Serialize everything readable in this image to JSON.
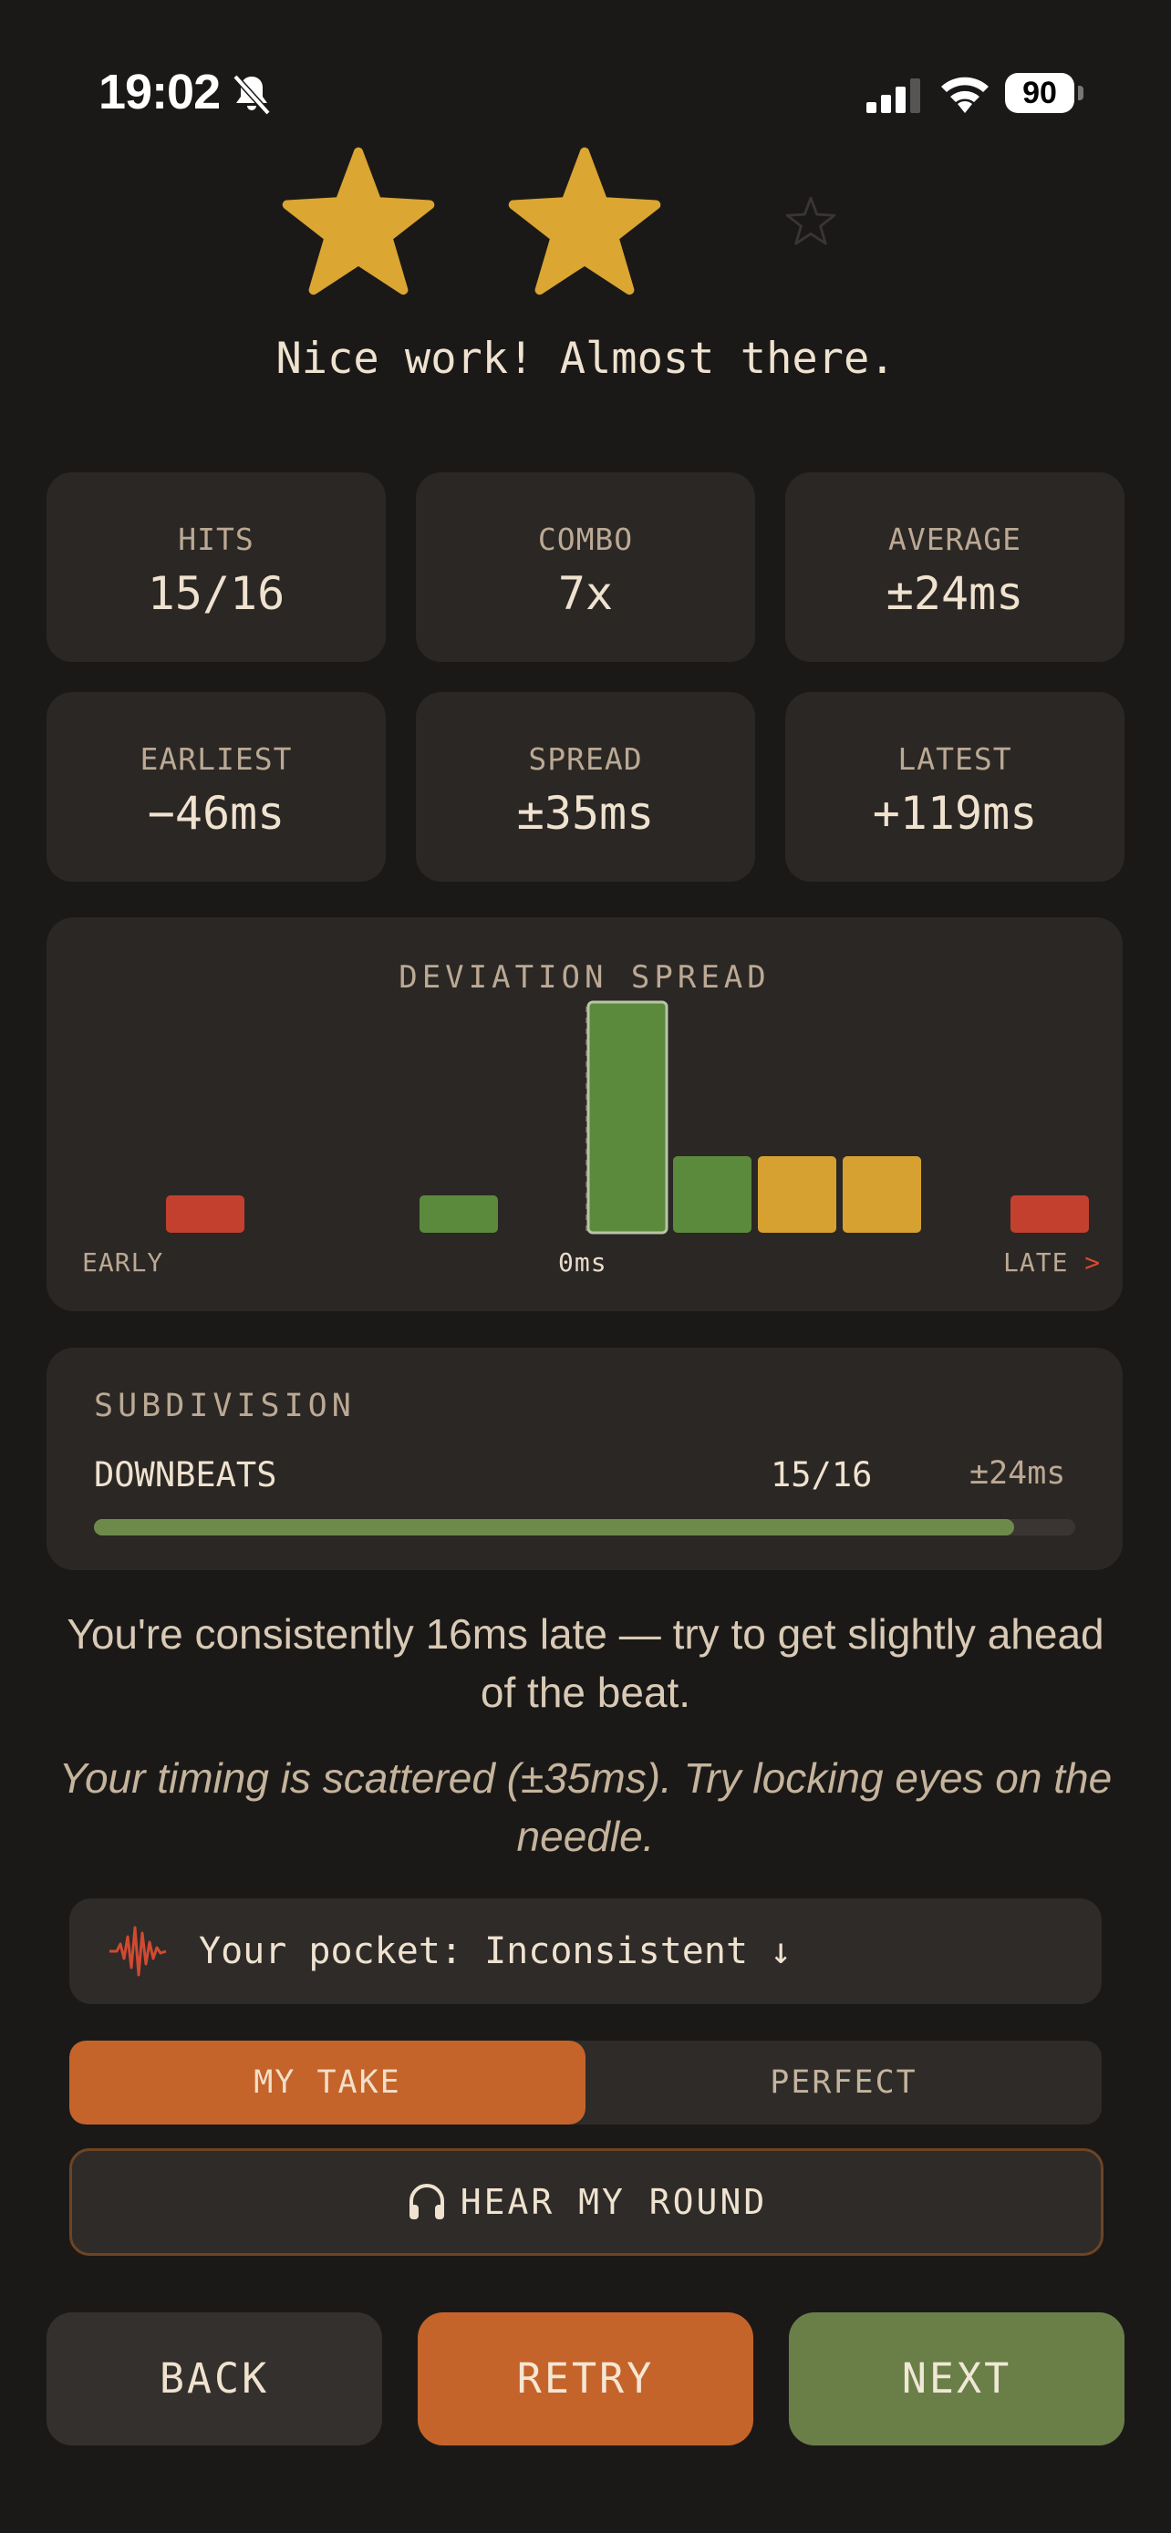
{
  "status_bar": {
    "time": "19:02",
    "battery": "90"
  },
  "rating": {
    "stars_earned": 2,
    "stars_total": 3,
    "headline": "Nice work! Almost there."
  },
  "stats": [
    {
      "label": "HITS",
      "value": "15/16"
    },
    {
      "label": "COMBO",
      "value": "7x"
    },
    {
      "label": "AVERAGE",
      "value": "±24ms"
    },
    {
      "label": "EARLIEST",
      "value": "−46ms"
    },
    {
      "label": "SPREAD",
      "value": "±35ms"
    },
    {
      "label": "LATEST",
      "value": "+119ms"
    }
  ],
  "deviation": {
    "title": "DEVIATION SPREAD",
    "early_label": "EARLY",
    "zero_label": "0ms",
    "late_label": "LATE",
    "late_arrow": ">",
    "colors": {
      "red": "#c4402e",
      "green": "#5c8a3c",
      "yellow": "#d6a130"
    }
  },
  "subdivision": {
    "title": "SUBDIVISION",
    "row_label": "DOWNBEATS",
    "count": "15/16",
    "avg": "±24ms",
    "progress": 0.9375
  },
  "feedback": {
    "primary": "You're consistently 16ms late — try to get slightly ahead of the beat.",
    "secondary": "Your timing is scattered (±35ms). Try locking eyes on the needle."
  },
  "pocket": {
    "text": "Your pocket: Inconsistent ↓",
    "icon": "waveform-icon"
  },
  "toggle": {
    "active": "MY TAKE",
    "inactive": "PERFECT"
  },
  "hear_button": {
    "label": "HEAR MY ROUND",
    "icon": "headphones-icon"
  },
  "actions": {
    "back": "BACK",
    "retry": "RETRY",
    "next": "NEXT"
  },
  "colors": {
    "accent": "#c4642a",
    "next": "#6a7f48",
    "star": "#dba631"
  }
}
